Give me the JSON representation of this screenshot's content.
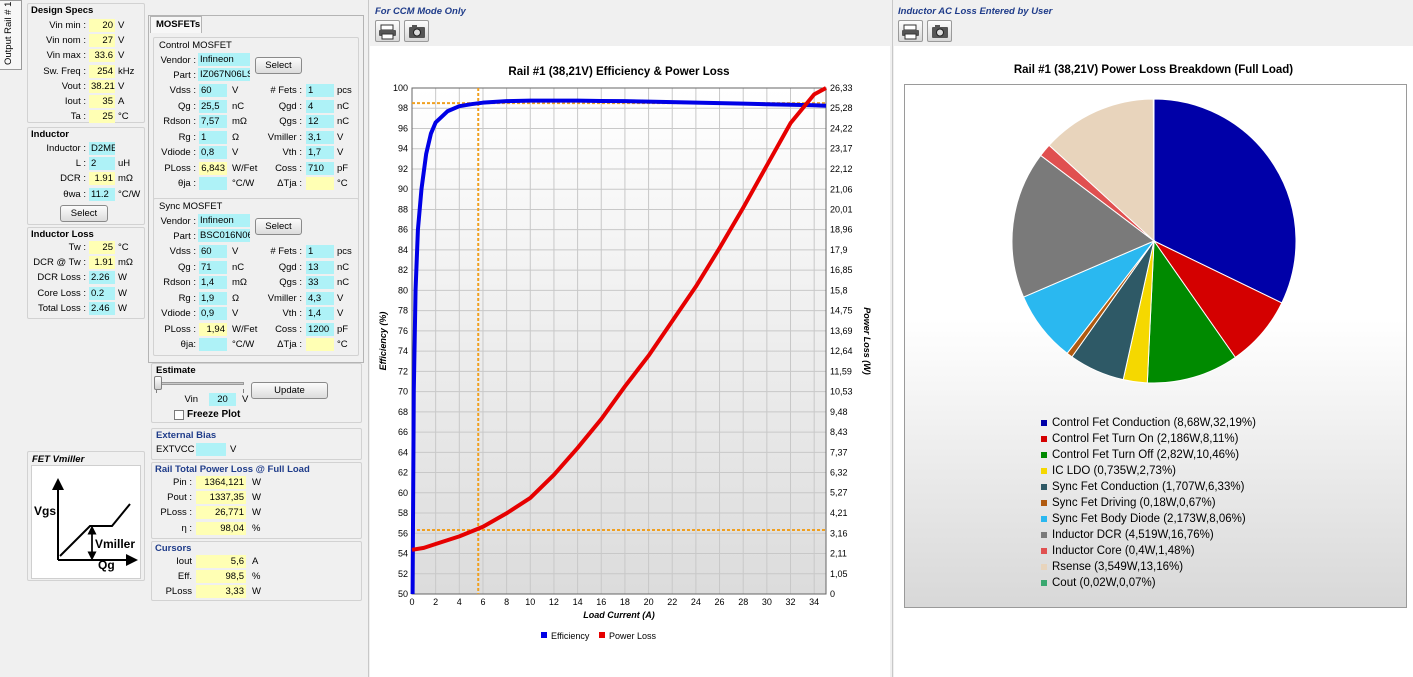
{
  "side_tab": "Output Rail # 1",
  "design_specs": {
    "title": "Design Specs",
    "rows": [
      {
        "label": "Vin min :",
        "value": "20",
        "unit": "V"
      },
      {
        "label": "Vin nom :",
        "value": "27",
        "unit": "V"
      },
      {
        "label": "Vin max :",
        "value": "33.6",
        "unit": "V"
      },
      {
        "label": "Sw. Freq :",
        "value": "254",
        "unit": "kHz"
      },
      {
        "label": "Vout :",
        "value": "38.21",
        "unit": "V"
      },
      {
        "label": "Iout :",
        "value": "35",
        "unit": "A"
      },
      {
        "label": "Ta :",
        "value": "25",
        "unit": "°C"
      }
    ]
  },
  "inductor": {
    "title": "Inductor",
    "rows": [
      {
        "label": "Inductor :",
        "value": "D2ME",
        "unit": ""
      },
      {
        "label": "L :",
        "value": "2",
        "unit": "uH"
      },
      {
        "label": "DCR :",
        "value": "1.91",
        "unit": "mΩ"
      },
      {
        "label": "θwa :",
        "value": "11.2",
        "unit": "°C/W"
      }
    ],
    "select_label": "Select"
  },
  "inductor_loss": {
    "title": "Inductor Loss",
    "rows": [
      {
        "label": "Tw :",
        "value": "25",
        "unit": "°C"
      },
      {
        "label": "DCR @ Tw :",
        "value": "1.91",
        "unit": "mΩ"
      },
      {
        "label": "DCR Loss :",
        "value": "2.26",
        "unit": "W"
      },
      {
        "label": "Core Loss :",
        "value": "0.2",
        "unit": "W"
      },
      {
        "label": "Total Loss :",
        "value": "2.46",
        "unit": "W"
      }
    ]
  },
  "fet_vmiller": {
    "title": "FET Vmiller",
    "vgs": "Vgs",
    "vmiller": "Vmiller",
    "qg": "Qg"
  },
  "mosfets": {
    "tab": "MOSFETs",
    "control": {
      "title": "Control MOSFET",
      "vendor_label": "Vendor :",
      "vendor": "Infineon",
      "part_label": "Part :",
      "part": "IZ067N06LS",
      "select_label": "Select",
      "left": [
        {
          "label": "Vdss :",
          "value": "60",
          "unit": "V"
        },
        {
          "label": "Qg :",
          "value": "25,5",
          "unit": "nC"
        },
        {
          "label": "Rdson :",
          "value": "7,57",
          "unit": "mΩ"
        },
        {
          "label": "Rg :",
          "value": "1",
          "unit": "Ω"
        },
        {
          "label": "Vdiode :",
          "value": "0,8",
          "unit": "V"
        },
        {
          "label": "PLoss :",
          "value": "6,843",
          "unit": "W/Fet"
        },
        {
          "label": "θja :",
          "value": "",
          "unit": "°C/W"
        }
      ],
      "right": [
        {
          "label": "# Fets :",
          "value": "1",
          "unit": "pcs"
        },
        {
          "label": "Qgd :",
          "value": "4",
          "unit": "nC"
        },
        {
          "label": "Qgs :",
          "value": "12",
          "unit": "nC"
        },
        {
          "label": "Vmiller :",
          "value": "3,1",
          "unit": "V"
        },
        {
          "label": "Vth :",
          "value": "1,7",
          "unit": "V"
        },
        {
          "label": "Coss :",
          "value": "710",
          "unit": "pF"
        },
        {
          "label": "ΔTja :",
          "value": "",
          "unit": "°C"
        }
      ]
    },
    "sync": {
      "title": "Sync MOSFET",
      "vendor_label": "Vendor :",
      "vendor": "Infineon",
      "part_label": "Part :",
      "part": "BSC016N06",
      "select_label": "Select",
      "left": [
        {
          "label": "Vdss :",
          "value": "60",
          "unit": "V"
        },
        {
          "label": "Qg :",
          "value": "71",
          "unit": "nC"
        },
        {
          "label": "Rdson :",
          "value": "1,4",
          "unit": "mΩ"
        },
        {
          "label": "Rg :",
          "value": "1,9",
          "unit": "Ω"
        },
        {
          "label": "Vdiode :",
          "value": "0,9",
          "unit": "V"
        },
        {
          "label": "PLoss :",
          "value": "1,94",
          "unit": "W/Fet"
        },
        {
          "label": "θja:",
          "value": "",
          "unit": "°C/W"
        }
      ],
      "right": [
        {
          "label": "# Fets :",
          "value": "1",
          "unit": "pcs"
        },
        {
          "label": "Qgd :",
          "value": "13",
          "unit": "nC"
        },
        {
          "label": "Qgs :",
          "value": "33",
          "unit": "nC"
        },
        {
          "label": "Vmiller :",
          "value": "4,3",
          "unit": "V"
        },
        {
          "label": "Vth :",
          "value": "1,4",
          "unit": "V"
        },
        {
          "label": "Coss :",
          "value": "1200",
          "unit": "pF"
        },
        {
          "label": "ΔTja :",
          "value": "",
          "unit": "°C"
        }
      ]
    }
  },
  "estimate": {
    "title": "Estimate",
    "update_label": "Update",
    "vin_label": "Vin",
    "vin": "20",
    "vin_unit": "V",
    "freeze_label": "Freeze Plot"
  },
  "external_bias": {
    "title": "External Bias",
    "label": "EXTVCC :",
    "value": "",
    "unit": "V"
  },
  "rail_total": {
    "title": "Rail Total Power Loss @ Full Load",
    "rows": [
      {
        "label": "Pin :",
        "value": "1364,121",
        "unit": "W"
      },
      {
        "label": "Pout :",
        "value": "1337,35",
        "unit": "W"
      },
      {
        "label": "PLoss :",
        "value": "26,771",
        "unit": "W"
      },
      {
        "label": "η :",
        "value": "98,04",
        "unit": "%"
      }
    ]
  },
  "cursors": {
    "title": "Cursors",
    "rows": [
      {
        "label": "Iout",
        "value": "5,6",
        "unit": "A"
      },
      {
        "label": "Eff.",
        "value": "98,5",
        "unit": "%"
      },
      {
        "label": "PLoss",
        "value": "3,33",
        "unit": "W"
      }
    ]
  },
  "left_chart_note": "For CCM Mode Only",
  "right_chart_note": "Inductor AC Loss Entered by User",
  "chart_data": [
    {
      "type": "line",
      "title": "Rail #1 (38,21V) Efficiency & Power Loss",
      "xlabel": "Load Current (A)",
      "ylabel": "Efficiency (%)",
      "y2label": "Power Loss (W)",
      "xlim": [
        0,
        35
      ],
      "ylim": [
        50,
        100
      ],
      "y2lim": [
        0,
        26.33
      ],
      "x_ticks": [
        "0",
        "2",
        "4",
        "6",
        "8",
        "10",
        "12",
        "14",
        "16",
        "18",
        "20",
        "22",
        "24",
        "26",
        "28",
        "30",
        "32",
        "34"
      ],
      "y_ticks": [
        "50",
        "52",
        "54",
        "56",
        "58",
        "60",
        "62",
        "64",
        "66",
        "68",
        "70",
        "72",
        "74",
        "76",
        "78",
        "80",
        "82",
        "84",
        "86",
        "88",
        "90",
        "92",
        "94",
        "96",
        "98",
        "100"
      ],
      "y2_ticks": [
        "0",
        "1,05",
        "2,11",
        "3,16",
        "4,21",
        "5,27",
        "6,32",
        "7,37",
        "8,43",
        "9,48",
        "10,53",
        "11,59",
        "12,64",
        "13,69",
        "14,75",
        "15,8",
        "16,85",
        "17,9",
        "18,96",
        "20,01",
        "21,06",
        "22,12",
        "23,17",
        "24,22",
        "25,28",
        "26,33"
      ],
      "legend": "bottom",
      "cursor": {
        "x": 5.6,
        "eff": 98.5,
        "ploss": 3.33
      },
      "series": [
        {
          "name": "Efficiency",
          "color": "#0000e6",
          "axis": "left",
          "x": [
            0.05,
            0.15,
            0.3,
            0.5,
            0.8,
            1.2,
            1.6,
            2,
            3,
            4,
            5,
            6,
            8,
            10,
            12,
            14,
            16,
            18,
            20,
            22,
            24,
            26,
            28,
            30,
            32,
            34,
            35
          ],
          "y": [
            50,
            70,
            80,
            86,
            90,
            93.5,
            95.5,
            96.6,
            97.7,
            98.2,
            98.4,
            98.55,
            98.7,
            98.75,
            98.75,
            98.75,
            98.72,
            98.7,
            98.65,
            98.6,
            98.55,
            98.5,
            98.45,
            98.4,
            98.35,
            98.3,
            98.25
          ]
        },
        {
          "name": "Power Loss",
          "color": "#e60000",
          "axis": "right",
          "x": [
            0,
            1,
            2,
            4,
            6,
            8,
            10,
            12,
            14,
            16,
            18,
            20,
            22,
            24,
            26,
            28,
            30,
            32,
            34,
            35
          ],
          "y": [
            2.3,
            2.4,
            2.6,
            3.0,
            3.5,
            4.2,
            5.0,
            6.2,
            7.6,
            9.1,
            10.8,
            12.4,
            14.2,
            16.0,
            18.0,
            20.1,
            22.3,
            24.5,
            26.0,
            26.33
          ]
        }
      ]
    },
    {
      "type": "pie",
      "title": "Rail #1 (38,21V) Power Loss Breakdown (Full Load)",
      "series": [
        {
          "name": "Control Fet Conduction (8,68W,32,19%)",
          "value": 32.19,
          "color": "#0000a8"
        },
        {
          "name": "Control Fet Turn On (2,186W,8,11%)",
          "value": 8.11,
          "color": "#d40000"
        },
        {
          "name": "Control Fet Turn Off (2,82W,10,46%)",
          "value": 10.46,
          "color": "#008a00"
        },
        {
          "name": "IC LDO (0,735W,2,73%)",
          "value": 2.73,
          "color": "#f5d800"
        },
        {
          "name": "Sync Fet Conduction (1,707W,6,33%)",
          "value": 6.33,
          "color": "#2e5966"
        },
        {
          "name": "Sync Fet Driving (0,18W,0,67%)",
          "value": 0.67,
          "color": "#b05a10"
        },
        {
          "name": "Sync Fet Body Diode (2,173W,8,06%)",
          "value": 8.06,
          "color": "#2ab8f0"
        },
        {
          "name": "Inductor DCR (4,519W,16,76%)",
          "value": 16.76,
          "color": "#7a7a7a"
        },
        {
          "name": "Inductor Core (0,4W,1,48%)",
          "value": 1.48,
          "color": "#e05050"
        },
        {
          "name": "Rsense (3,549W,13,16%)",
          "value": 13.16,
          "color": "#e8d4bc"
        },
        {
          "name": "Cout (0,02W,0,07%)",
          "value": 0.07,
          "color": "#3aa870"
        }
      ]
    }
  ]
}
